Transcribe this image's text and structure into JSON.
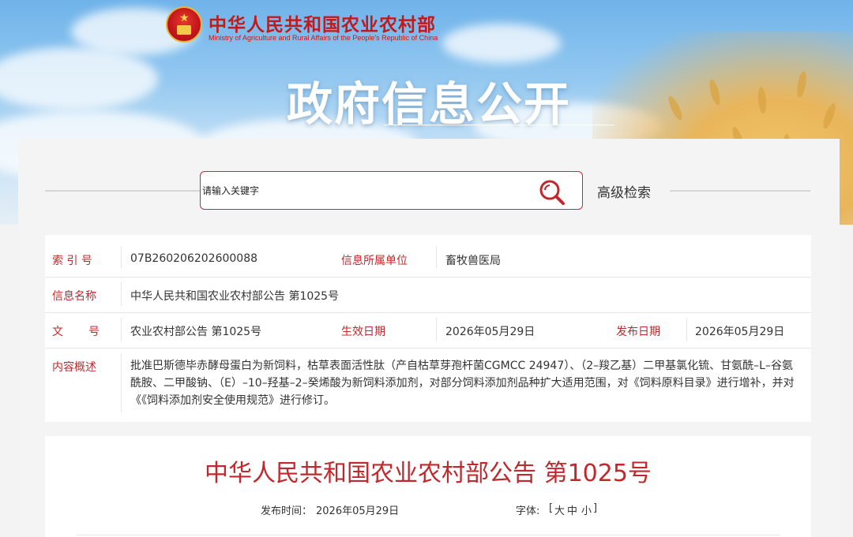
{
  "header": {
    "site_title": "中华人民共和国农业农村部",
    "site_subtitle": "Ministry of Agriculture and Rural Affairs of the People's Republic of China",
    "section_title": "政府信息公开"
  },
  "search": {
    "placeholder": "请输入关键字",
    "advanced_label": "高级检索",
    "icon": "search-icon"
  },
  "info": {
    "index_label": "索 引 号",
    "index_value": "07B260206202600088",
    "unit_label": "信息所属单位",
    "unit_value": "畜牧兽医局",
    "name_label": "信息名称",
    "name_value": "中华人民共和国农业农村部公告 第1025号",
    "doc_label_1": "文",
    "doc_label_2": "号",
    "doc_value": "农业农村部公告 第1025号",
    "effective_label": "生效日期",
    "effective_value": "2026年05月29日",
    "publish_label": "发布日期",
    "publish_value": "2026年05月29日",
    "summary_label": "内容概述",
    "summary_value": "批准巴斯德毕赤酵母蛋白为新饲料，枯草表面活性肽（产自枯草芽孢杆菌CGMCC 24947）、（2–羧乙基）二甲基氯化锍、甘氨酰–L–谷氨酰胺、二甲酸钠、（E）–10–羟基–2–癸烯酸为新饲料添加剂，对部分饲料添加剂品种扩大适用范围，对《饲料原料目录》进行增补，并对《《饲料添加剂安全使用规范》进行修订。"
  },
  "article": {
    "title": "中华人民共和国农业农村部公告 第1025号",
    "publish_time_label": "发布时间：",
    "publish_time_value": "2026年05月29日",
    "font_label": "字体:",
    "font_open": "[",
    "font_large": "大",
    "font_medium": "中",
    "font_small": "小",
    "font_close": "]"
  },
  "colors": {
    "accent_red": "#c0282d",
    "sky_blue": "#6fb3ea"
  }
}
